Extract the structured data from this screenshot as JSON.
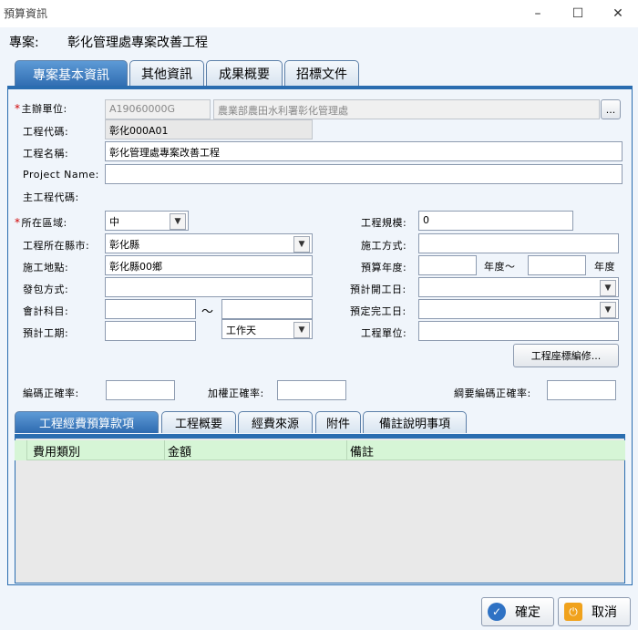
{
  "window": {
    "title": "預算資訊",
    "minimize_glyph": "–",
    "maximize_glyph": "☐",
    "close_glyph": "✕"
  },
  "project": {
    "label": "專案:",
    "name": "彰化管理處專案改善工程"
  },
  "main_tabs": [
    {
      "label": "專案基本資訊",
      "active": true
    },
    {
      "label": "其他資訊",
      "active": false
    },
    {
      "label": "成果概要",
      "active": false
    },
    {
      "label": "招標文件",
      "active": false
    }
  ],
  "form": {
    "sponsor_unit": {
      "label": "主辦單位:",
      "code": "A19060000G",
      "name": "農業部農田水利署彰化管理處",
      "browse": "..."
    },
    "project_code": {
      "label": "工程代碼:",
      "value": "彰化000A01"
    },
    "project_name": {
      "label": "工程名稱:",
      "value": "彰化管理處專案改善工程"
    },
    "project_name_en": {
      "label": "Project Name:",
      "value": ""
    },
    "main_code": {
      "label": "主工程代碼:"
    },
    "region": {
      "label": "所在區域:",
      "value": "中"
    },
    "county": {
      "label": "工程所在縣市:",
      "value": "彰化縣"
    },
    "site": {
      "label": "施工地點:",
      "value": "彰化縣00鄉"
    },
    "contract_method": {
      "label": "發包方式:",
      "value": ""
    },
    "account_subject": {
      "label": "會計科目:",
      "from": "",
      "to": "",
      "tilde": "～"
    },
    "duration": {
      "label": "預計工期:",
      "value": "",
      "unit": "工作天"
    },
    "scale": {
      "label": "工程規模:",
      "value": "0"
    },
    "construction_method": {
      "label": "施工方式:",
      "value": ""
    },
    "budget_year": {
      "label": "預算年度:",
      "from": "",
      "to": "",
      "mid": "年度～",
      "end": "年度"
    },
    "start_date": {
      "label": "預計開工日:",
      "value": ""
    },
    "end_date": {
      "label": "預定完工日:",
      "value": ""
    },
    "unit": {
      "label": "工程單位:",
      "value": ""
    },
    "coord_button": "工程座標編修...",
    "coding_rate": {
      "label": "編碼正確率:",
      "value": ""
    },
    "weighted_rate": {
      "label": "加權正確率:",
      "value": ""
    },
    "outline_rate": {
      "label": "綱要編碼正確率:",
      "value": ""
    }
  },
  "sub_tabs": [
    {
      "label": "工程經費預算款項",
      "active": true
    },
    {
      "label": "工程概要",
      "active": false
    },
    {
      "label": "經費來源",
      "active": false
    },
    {
      "label": "附件",
      "active": false
    },
    {
      "label": "備註說明事項",
      "active": false
    }
  ],
  "grid": {
    "columns": [
      "費用類別",
      "金額",
      "備註"
    ]
  },
  "buttons": {
    "ok": "確定",
    "cancel": "取消"
  },
  "colors": {
    "accent": "#2a6db0",
    "required": "#d00000",
    "grid_header": "#d6f5d6"
  }
}
